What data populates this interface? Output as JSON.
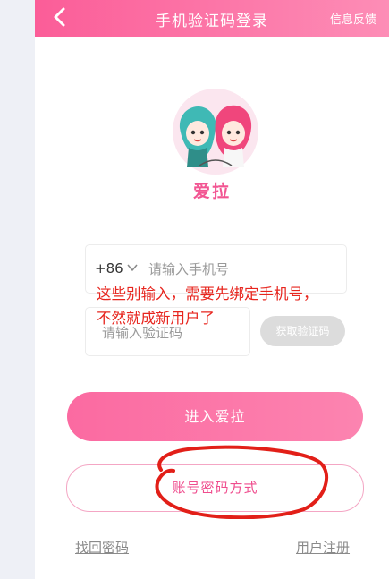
{
  "header": {
    "title": "手机验证码登录",
    "feedback_label": "信息反馈",
    "back_icon": "back-arrow-icon",
    "gradient_from": "#fb5d98",
    "gradient_to": "#fd8db6"
  },
  "app": {
    "name": "爱拉",
    "logo_icon": "couple-logo-icon"
  },
  "form": {
    "country_code": "+86",
    "phone_placeholder": "请输入手机号",
    "code_placeholder": "请输入验证码",
    "get_code_label": "获取验证码"
  },
  "annotation": {
    "line1": "这些别输入，需要先绑定手机号，",
    "line2": "不然就成新用户了",
    "color": "#e7251e"
  },
  "buttons": {
    "enter_label": "进入爱拉",
    "account_login_label": "账号密码方式"
  },
  "footer": {
    "retrieve_password": "找回密码",
    "register": "用户注册"
  },
  "colors": {
    "accent": "#f25592",
    "button_pink": "#fb6aa1",
    "disabled_gray": "#dcdcdc"
  }
}
